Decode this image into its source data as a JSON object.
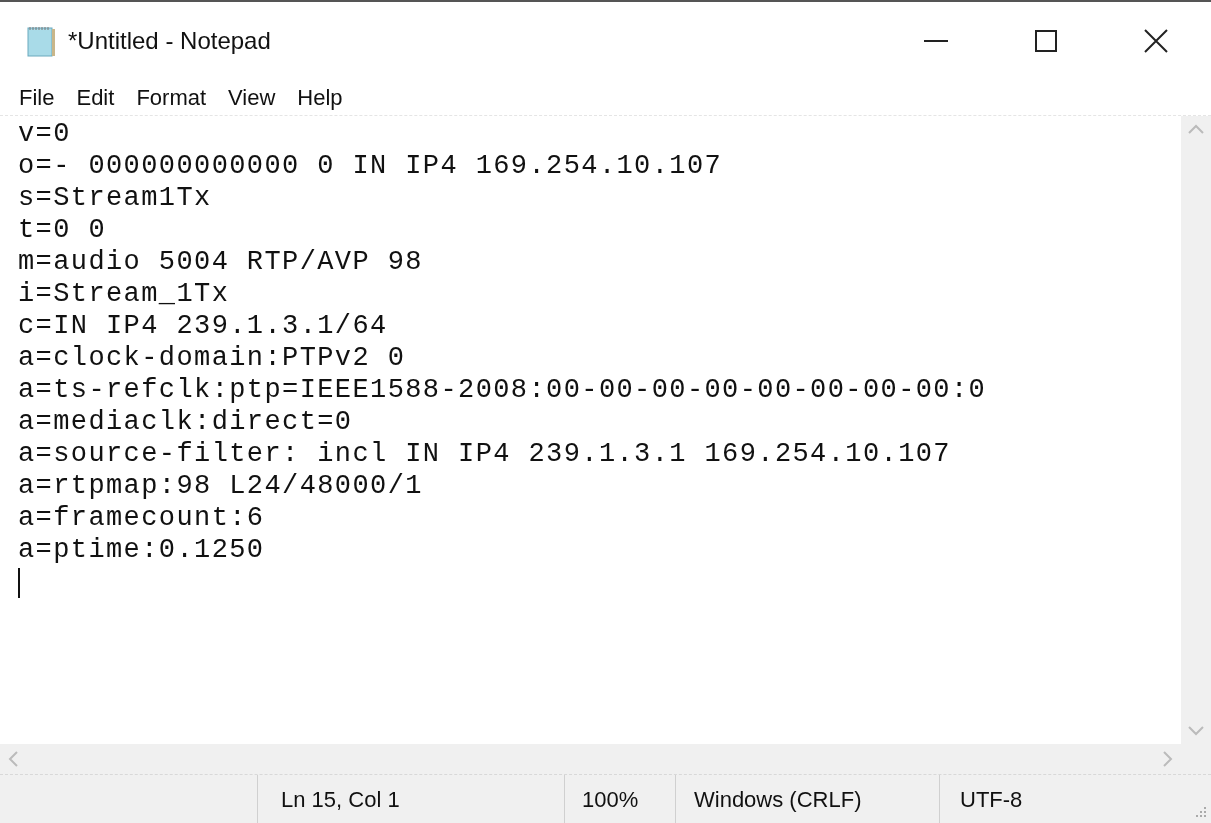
{
  "window": {
    "title": "*Untitled - Notepad"
  },
  "menu": [
    "File",
    "Edit",
    "Format",
    "View",
    "Help"
  ],
  "editor": {
    "lines": [
      "v=0",
      "o=- 000000000000 0 IN IP4 169.254.10.107",
      "s=Stream1Tx",
      "t=0 0",
      "m=audio 5004 RTP/AVP 98",
      "i=Stream_1Tx",
      "c=IN IP4 239.1.3.1/64",
      "a=clock-domain:PTPv2 0",
      "a=ts-refclk:ptp=IEEE1588-2008:00-00-00-00-00-00-00-00:0",
      "a=mediaclk:direct=0",
      "a=source-filter: incl IN IP4 239.1.3.1 169.254.10.107",
      "a=rtpmap:98 L24/48000/1",
      "a=framecount:6",
      "a=ptime:0.1250"
    ]
  },
  "status_bar": {
    "position": "Ln 15, Col 1",
    "zoom": "100%",
    "line_ending": "Windows (CRLF)",
    "encoding": "UTF-8"
  }
}
